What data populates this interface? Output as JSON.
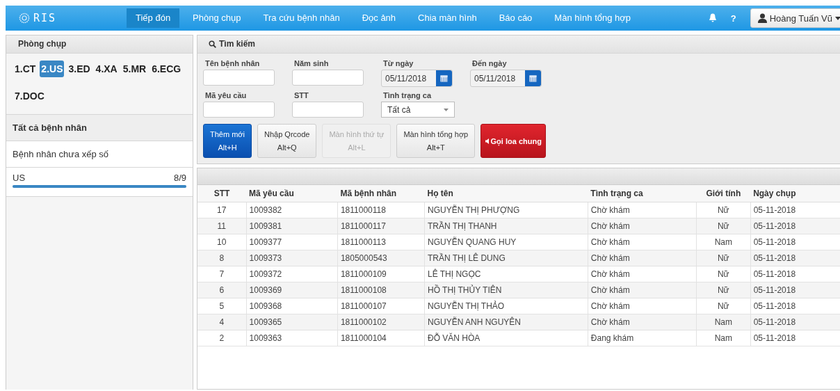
{
  "navbar": {
    "logo": "RIS",
    "items": [
      {
        "label": "Tiếp đón",
        "selected": true
      },
      {
        "label": "Phòng chụp",
        "selected": false
      },
      {
        "label": "Tra cứu bệnh nhân",
        "selected": false
      },
      {
        "label": "Đọc ảnh",
        "selected": false
      },
      {
        "label": "Chia màn hình",
        "selected": false
      },
      {
        "label": "Báo cáo",
        "selected": false
      },
      {
        "label": "Màn hình tổng hợp",
        "selected": false
      }
    ],
    "help": "?",
    "user": "Hoàng Tuấn Vũ"
  },
  "sidebar": {
    "title": "Phòng chụp",
    "rooms": [
      {
        "label": "1.CT",
        "selected": false
      },
      {
        "label": "2.US",
        "selected": true
      },
      {
        "label": "3.ED",
        "selected": false
      },
      {
        "label": "4.XA",
        "selected": false
      },
      {
        "label": "5.MR",
        "selected": false
      },
      {
        "label": "6.ECG",
        "selected": false
      },
      {
        "label": "7.DOC",
        "selected": false
      }
    ],
    "all_patients": "Tất cả bệnh nhân",
    "unassigned": "Bệnh nhân chưa xếp số",
    "queue": {
      "name": "US",
      "count": "8/9",
      "level": 1
    }
  },
  "search": {
    "title": "Tìm kiếm",
    "fields": [
      {
        "kind": "text",
        "label": "Tên bệnh nhân"
      },
      {
        "kind": "text",
        "label": "Năm sinh"
      },
      {
        "kind": "date",
        "label": "Từ ngày",
        "value": "05/11/2018"
      },
      {
        "kind": "date",
        "label": "Đến ngày",
        "value": "05/11/2018"
      },
      {
        "kind": "text",
        "label": "Mã yêu cầu"
      },
      {
        "kind": "text",
        "label": "STT"
      },
      {
        "kind": "select",
        "label": "Tình trạng ca",
        "value": "Tất cả"
      }
    ],
    "buttons": [
      {
        "kind": "primary",
        "label": "Thêm mới",
        "shortcut": "Alt+H"
      },
      {
        "kind": "default",
        "label": "Nhập Qrcode",
        "shortcut": "Alt+Q"
      },
      {
        "kind": "disabled",
        "label": "Màn hình thứ tự",
        "shortcut": "Alt+L"
      },
      {
        "kind": "default",
        "label": "Màn hình tổng hợp",
        "shortcut": "Alt+T"
      },
      {
        "kind": "danger",
        "label": "Gọi loa chung"
      }
    ]
  },
  "table": {
    "columns": [
      "STT",
      "Mã yêu cầu",
      "Mã bệnh nhân",
      "Họ tên",
      "Tình trạng ca",
      "Giới tính",
      "Ngày chụp"
    ],
    "rows": [
      [
        "17",
        "1009382",
        "1811000118",
        "NGUYỄN THỊ PHƯỢNG",
        "Chờ khám",
        "Nữ",
        "05-11-2018"
      ],
      [
        "11",
        "1009381",
        "1811000117",
        "TRẦN THỊ THANH",
        "Chờ khám",
        "Nữ",
        "05-11-2018"
      ],
      [
        "10",
        "1009377",
        "1811000113",
        "NGUYỄN QUANG HUY",
        "Chờ khám",
        "Nam",
        "05-11-2018"
      ],
      [
        "8",
        "1009373",
        "1805000543",
        "TRẦN THỊ LÊ DUNG",
        "Chờ khám",
        "Nữ",
        "05-11-2018"
      ],
      [
        "7",
        "1009372",
        "1811000109",
        "LÊ THỊ NGỌC",
        "Chờ khám",
        "Nữ",
        "05-11-2018"
      ],
      [
        "6",
        "1009369",
        "1811000108",
        "HỒ THỊ THỦY TIÊN",
        "Chờ khám",
        "Nữ",
        "05-11-2018"
      ],
      [
        "5",
        "1009368",
        "1811000107",
        "NGUYỄN THỊ THẢO",
        "Chờ khám",
        "Nữ",
        "05-11-2018"
      ],
      [
        "4",
        "1009365",
        "1811000102",
        "NGUYỄN ANH NGUYÊN",
        "Chờ khám",
        "Nam",
        "05-11-2018"
      ],
      [
        "2",
        "1009363",
        "1811000104",
        "ĐỖ VĂN HÒA",
        "Đang khám",
        "Nam",
        "05-11-2018"
      ]
    ]
  }
}
